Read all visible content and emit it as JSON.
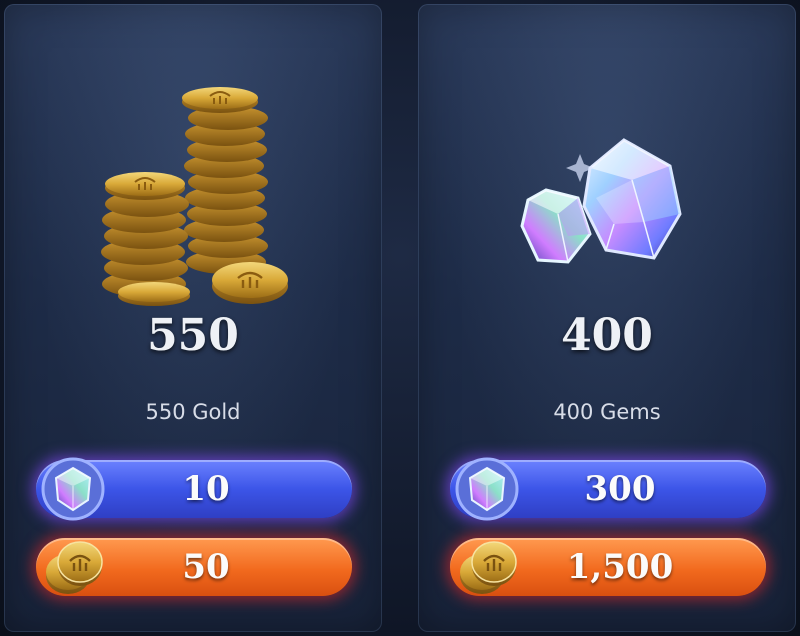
{
  "offers": [
    {
      "amount": "550",
      "description": "550 Gold",
      "art_icon": "gold-coins-stack-icon",
      "prices": [
        {
          "currency_icon": "gem-icon",
          "label": "10"
        },
        {
          "currency_icon": "gold-coin-icon",
          "label": "50"
        }
      ]
    },
    {
      "amount": "400",
      "description": "400 Gems",
      "art_icon": "gems-icon",
      "prices": [
        {
          "currency_icon": "gem-icon",
          "label": "300"
        },
        {
          "currency_icon": "gold-coin-icon",
          "label": "1,500"
        }
      ]
    }
  ],
  "colors": {
    "gem_button": "#3c55e8",
    "gold_button": "#f26a1e",
    "card_bg": "#1e2c48",
    "text": "#eef1f6"
  }
}
